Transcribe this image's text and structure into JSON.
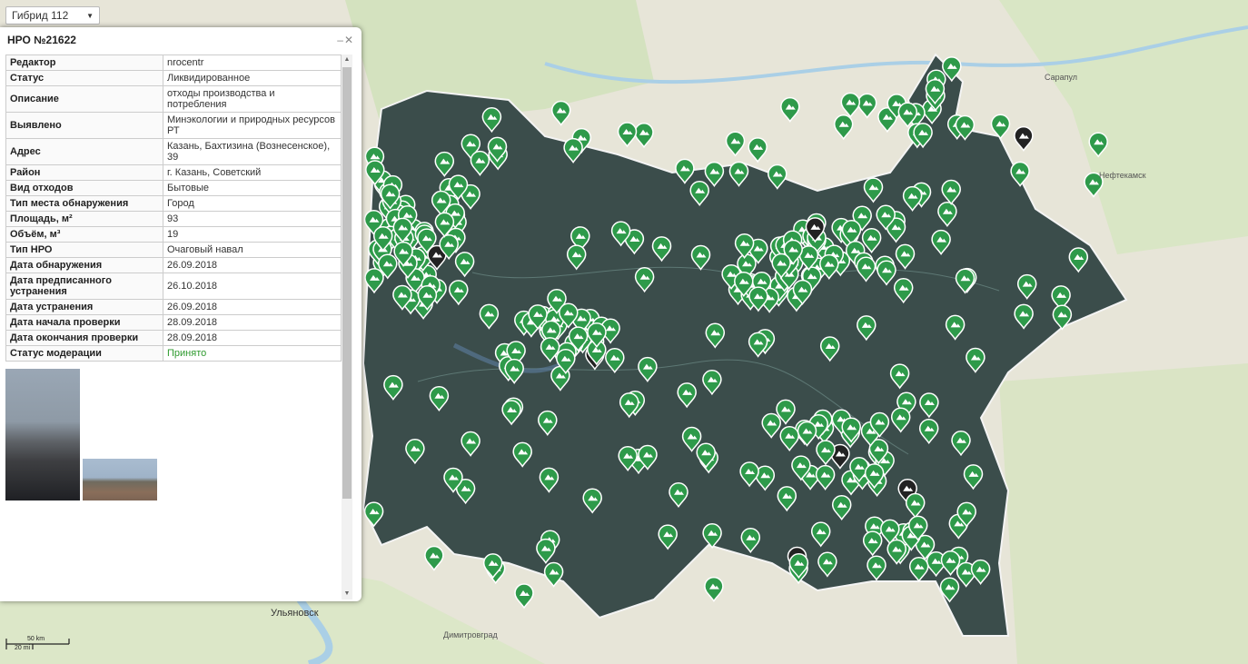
{
  "map": {
    "layer_selector": "Гибрид 112",
    "cities": {
      "sarapul": "Сарапул",
      "neftekamsk": "Нефтекамск",
      "ulyanovsk": "Ульяновск",
      "dimitrovgrad": "Димитровград"
    },
    "scale": {
      "metric": "50 km",
      "imperial": "20 mi"
    },
    "marker_color": "#2e9a4a",
    "selected_marker_color": "#222222"
  },
  "popup": {
    "title": "НРО №21622",
    "controls": "–✕",
    "rows": [
      {
        "key": "Редактор",
        "value": "nrocentr"
      },
      {
        "key": "Статус",
        "value": "Ликвидированное"
      },
      {
        "key": "Описание",
        "value": "отходы производства и потребления"
      },
      {
        "key": "Выявлено",
        "value": "Минэкологии и природных ресурсов РТ"
      },
      {
        "key": "Адрес",
        "value": "Казань, Бахтизина (Вознесенское), 39"
      },
      {
        "key": "Район",
        "value": "г. Казань, Советский"
      },
      {
        "key": "Вид отходов",
        "value": "Бытовые"
      },
      {
        "key": "Тип места обнаружения",
        "value": "Город"
      },
      {
        "key": "Площадь, м²",
        "value": "93"
      },
      {
        "key": "Объём, м³",
        "value": "19"
      },
      {
        "key": "Тип НРО",
        "value": "Очаговый навал"
      },
      {
        "key": "Дата обнаружения",
        "value": "26.09.2018"
      },
      {
        "key": "Дата предписанного устранения",
        "value": "26.10.2018"
      },
      {
        "key": "Дата устранения",
        "value": "26.09.2018"
      },
      {
        "key": "Дата начала проверки",
        "value": "28.09.2018"
      },
      {
        "key": "Дата окончания проверки",
        "value": "28.09.2018"
      },
      {
        "key": "Статус модерации",
        "value": "Принято"
      }
    ],
    "status_color": "#2e9a2e"
  }
}
